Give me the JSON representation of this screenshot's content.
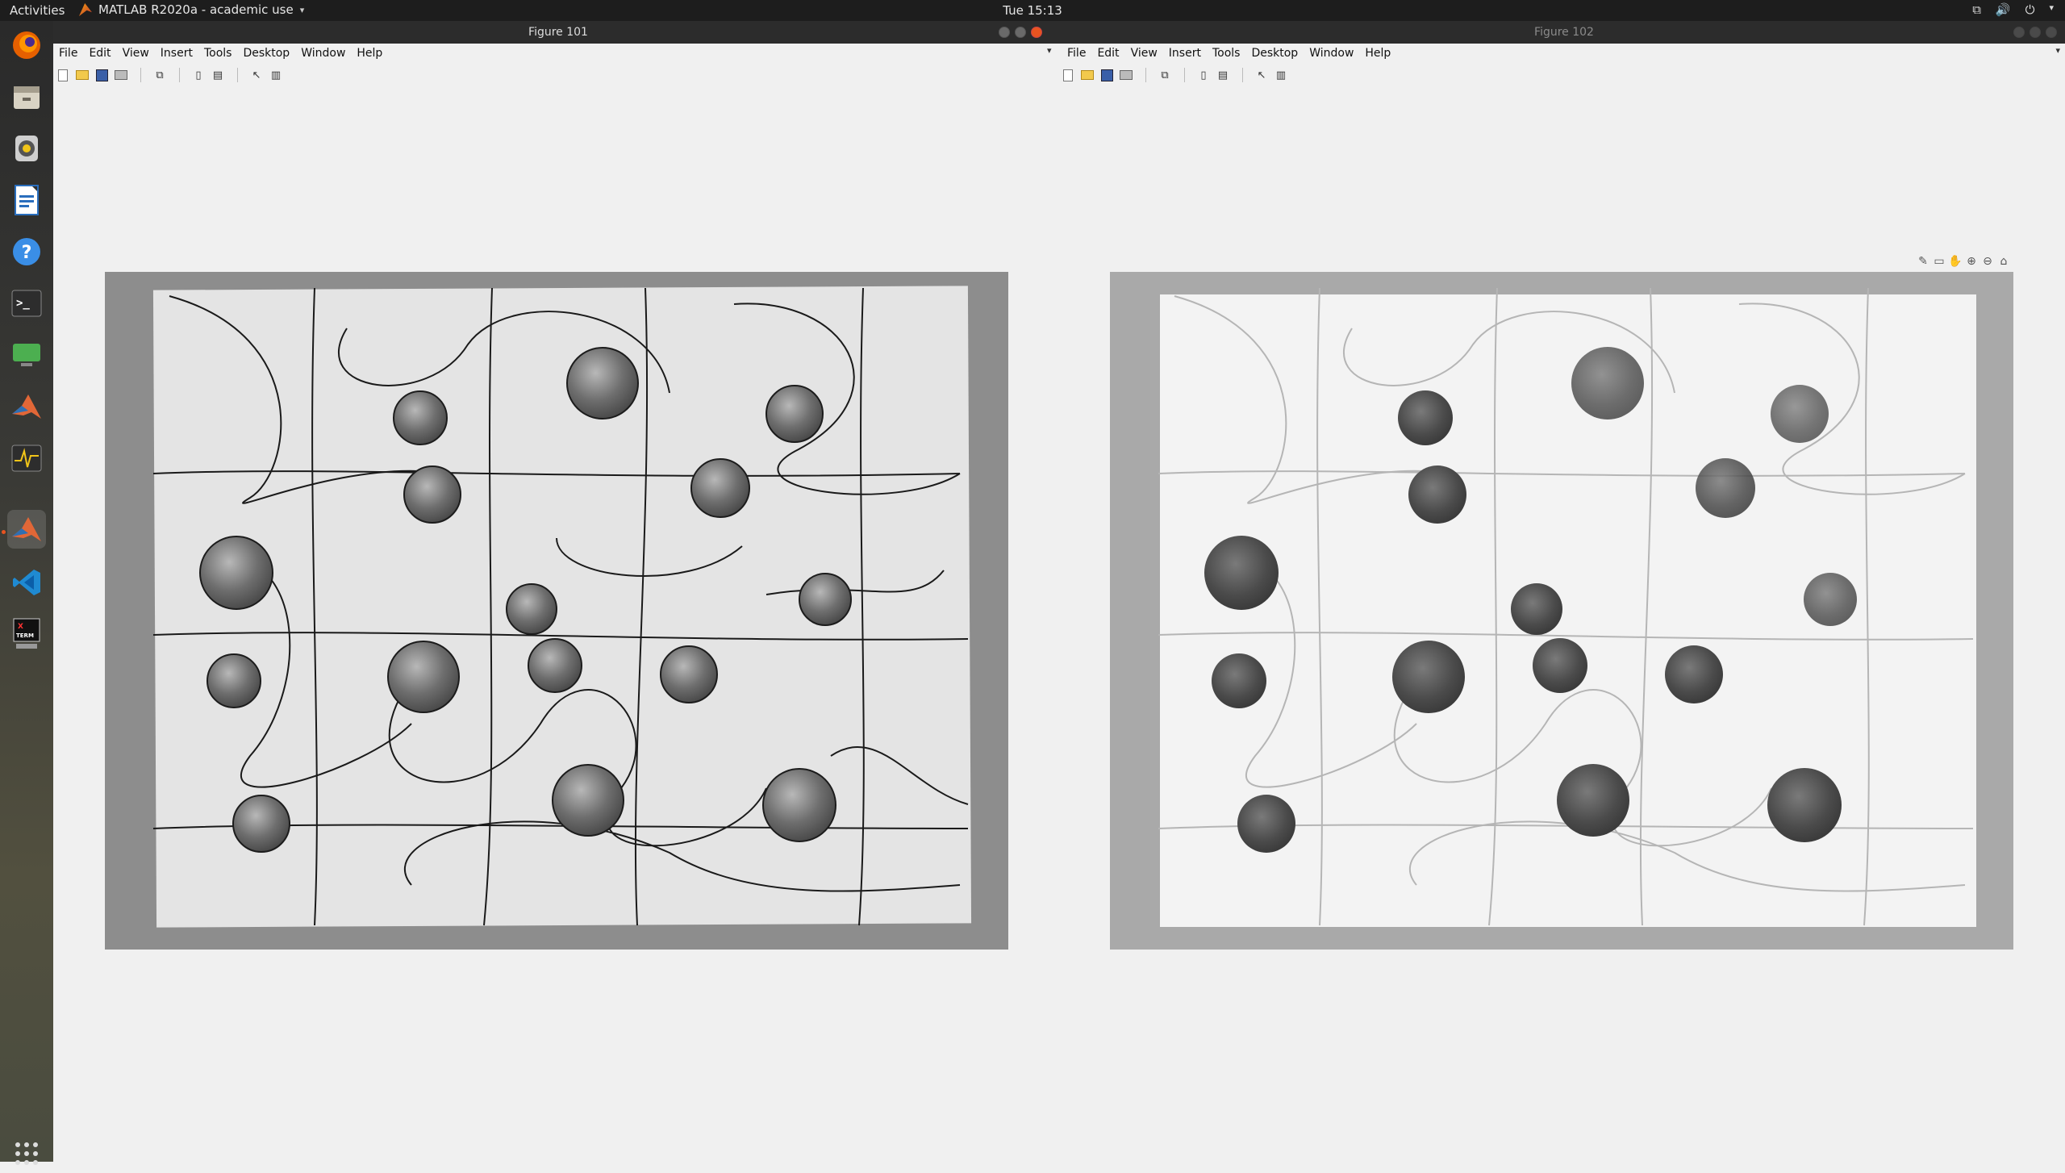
{
  "topbar": {
    "activities": "Activities",
    "app_title": "MATLAB R2020a - academic use",
    "clock": "Tue 15:13"
  },
  "dock": {
    "items": [
      {
        "name": "firefox-icon"
      },
      {
        "name": "files-icon"
      },
      {
        "name": "rhythmbox-icon"
      },
      {
        "name": "writer-icon"
      },
      {
        "name": "help-icon"
      },
      {
        "name": "terminal-icon"
      },
      {
        "name": "remote-desktop-icon"
      },
      {
        "name": "matlab-icon"
      },
      {
        "name": "system-monitor-icon"
      },
      {
        "name": "matlab-active-icon"
      },
      {
        "name": "vscode-icon"
      },
      {
        "name": "xterm-icon"
      },
      {
        "name": "show-apps-icon"
      }
    ]
  },
  "figure101": {
    "title": "Figure 101",
    "menu": [
      "File",
      "Edit",
      "View",
      "Insert",
      "Tools",
      "Desktop",
      "Window",
      "Help"
    ]
  },
  "figure102": {
    "title": "Figure 102",
    "menu": [
      "File",
      "Edit",
      "View",
      "Insert",
      "Tools",
      "Desktop",
      "Window",
      "Help"
    ]
  },
  "colors": {
    "topbar": "#1d1d1d",
    "accent": "#e95420",
    "figure_bg": "#f0f0f0"
  }
}
